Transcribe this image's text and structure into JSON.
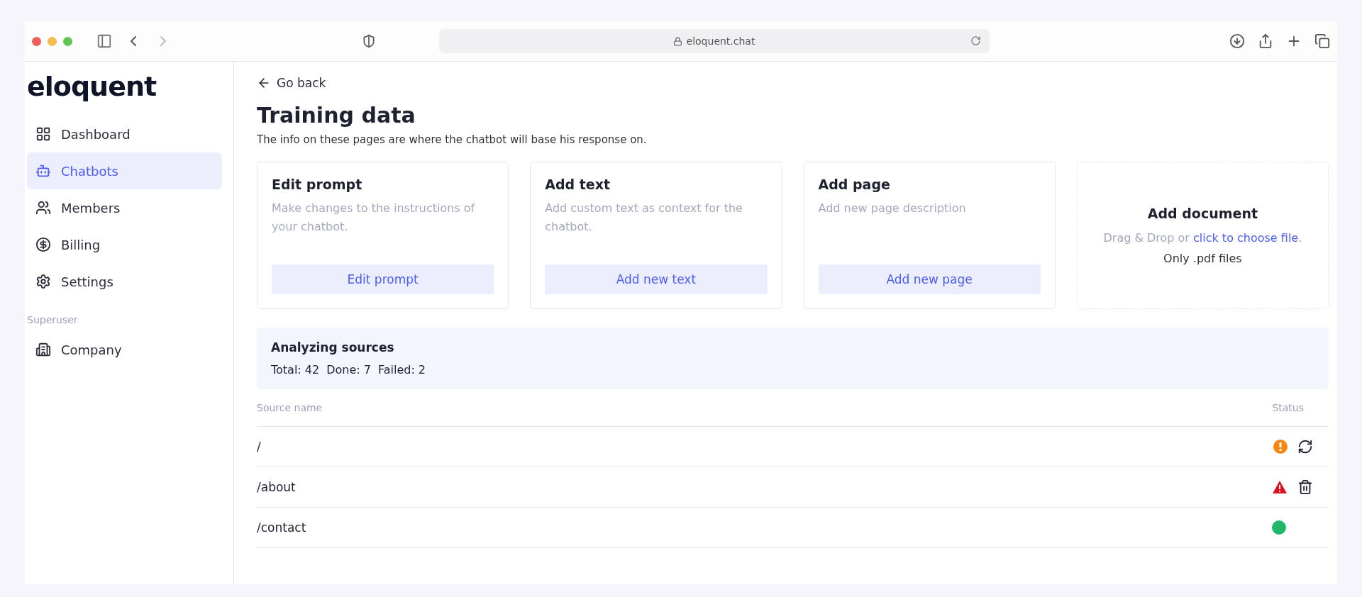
{
  "browser": {
    "address": "eloquent.chat"
  },
  "sidebar": {
    "logo": "eloquent",
    "items": [
      {
        "label": "Dashboard",
        "selected": false
      },
      {
        "label": "Chatbots",
        "selected": true
      },
      {
        "label": "Members",
        "selected": false
      },
      {
        "label": "Billing",
        "selected": false
      },
      {
        "label": "Settings",
        "selected": false
      }
    ],
    "section_label": "Superuser",
    "section_items": [
      {
        "label": "Company",
        "selected": false
      }
    ]
  },
  "back_link": "Go back",
  "title": "Training data",
  "subtitle": "The info on these pages are where the chatbot will base his response on.",
  "cards": [
    {
      "kind": "action",
      "title": "Edit prompt",
      "description": "Make changes to the instructions of your chatbot.",
      "button": "Edit prompt"
    },
    {
      "kind": "action",
      "title": "Add text",
      "description": "Add custom text as context for the chatbot.",
      "button": "Add new text"
    },
    {
      "kind": "action",
      "title": "Add page",
      "description": "Add new page description",
      "button": "Add new page"
    },
    {
      "kind": "upload",
      "title": "Add document",
      "hint": "Drag & Drop or",
      "link": "click to choose file",
      "hint_end": ".",
      "note": "Only .pdf files"
    }
  ],
  "analysis": {
    "title": "Analyzing sources",
    "stats": [
      "Total: 42",
      "Done: 7",
      "Failed: 2"
    ]
  },
  "table": {
    "columns": [
      "Source name",
      "Status"
    ],
    "rows": [
      {
        "name": "/",
        "kind": "warning"
      },
      {
        "name": "/about",
        "kind": "error"
      },
      {
        "name": "/contact",
        "kind": "success"
      }
    ]
  }
}
